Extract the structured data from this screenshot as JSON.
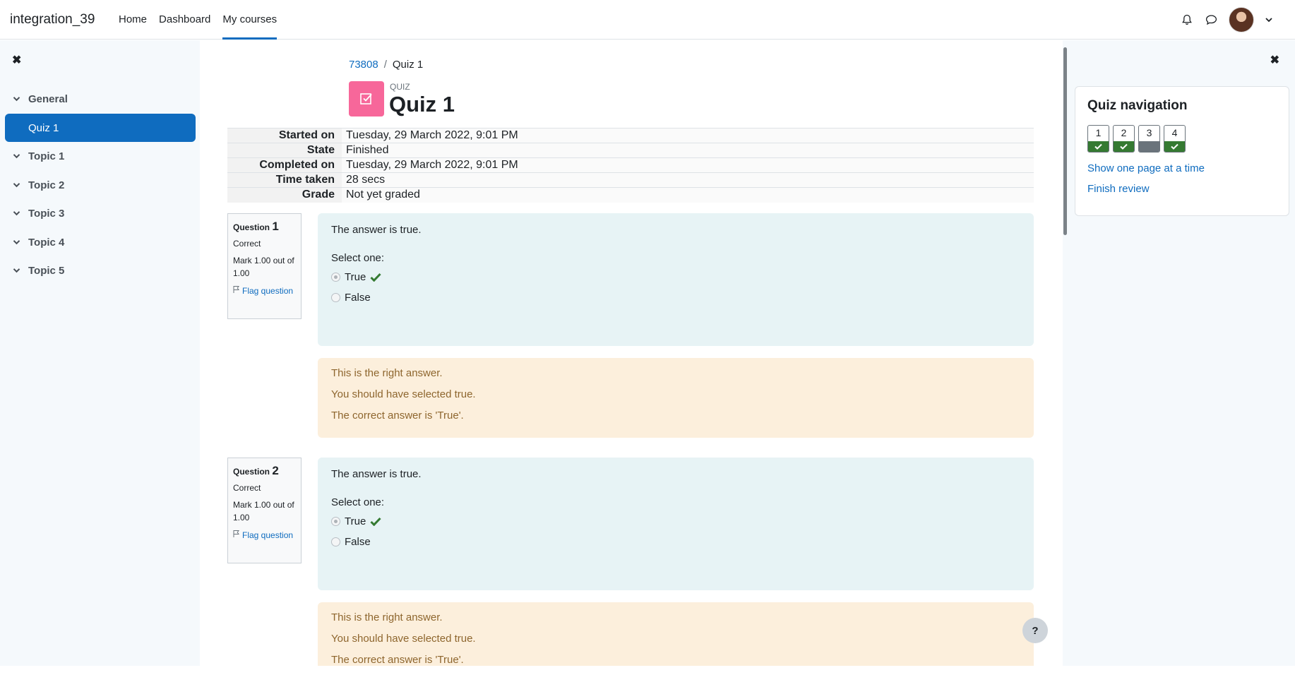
{
  "navbar": {
    "brand": "integration_39",
    "links": [
      {
        "label": "Home"
      },
      {
        "label": "Dashboard"
      },
      {
        "label": "My courses"
      }
    ]
  },
  "course_index": {
    "close_symbol": "✖",
    "items": [
      {
        "label": "General",
        "icon": "chevron-down-icon"
      },
      {
        "label": "Quiz 1"
      },
      {
        "label": "Topic 1",
        "icon": "chevron-down-icon"
      },
      {
        "label": "Topic 2",
        "icon": "chevron-down-icon"
      },
      {
        "label": "Topic 3",
        "icon": "chevron-down-icon"
      },
      {
        "label": "Topic 4",
        "icon": "chevron-down-icon"
      },
      {
        "label": "Topic 5",
        "icon": "chevron-down-icon"
      }
    ]
  },
  "breadcrumb": {
    "course": "73808",
    "separator": "/",
    "current": "Quiz 1"
  },
  "header": {
    "type_label": "QUIZ",
    "title": "Quiz 1",
    "icon_color": "#f7679a"
  },
  "summary": [
    {
      "label": "Started on",
      "value": "Tuesday, 29 March 2022, 9:01 PM"
    },
    {
      "label": "State",
      "value": "Finished"
    },
    {
      "label": "Completed on",
      "value": "Tuesday, 29 March 2022, 9:01 PM"
    },
    {
      "label": "Time taken",
      "value": "28 secs"
    },
    {
      "label": "Grade",
      "value": "Not yet graded"
    }
  ],
  "questions": [
    {
      "prefix": "Question",
      "number": "1",
      "state": "Correct",
      "mark": "Mark 1.00 out of 1.00",
      "flag": "Flag question",
      "text": "The answer is true.",
      "prompt": "Select one:",
      "options": [
        {
          "label": "True"
        },
        {
          "label": "False"
        }
      ],
      "feedback": [
        "This is the right answer.",
        "You should have selected true.",
        "The correct answer is 'True'."
      ]
    },
    {
      "prefix": "Question",
      "number": "2",
      "state": "Correct",
      "mark": "Mark 1.00 out of 1.00",
      "flag": "Flag question",
      "text": "The answer is true.",
      "prompt": "Select one:",
      "options": [
        {
          "label": "True"
        },
        {
          "label": "False"
        }
      ],
      "feedback": [
        "This is the right answer.",
        "You should have selected true.",
        "The correct answer is 'True'."
      ]
    }
  ],
  "quiz_navigation": {
    "close_symbol": "✖",
    "title": "Quiz navigation",
    "buttons": [
      {
        "number": "1",
        "status": "correct"
      },
      {
        "number": "2",
        "status": "correct"
      },
      {
        "number": "3",
        "status": "not-graded"
      },
      {
        "number": "4",
        "status": "correct"
      }
    ],
    "links": [
      "Show one page at a time",
      "Finish review"
    ]
  },
  "help": {
    "label": "?"
  },
  "colors": {
    "primary": "#0f6cbf",
    "correct": "#357a32",
    "question_bg": "#e7f3f5",
    "feedback_bg": "#fcefdc"
  }
}
